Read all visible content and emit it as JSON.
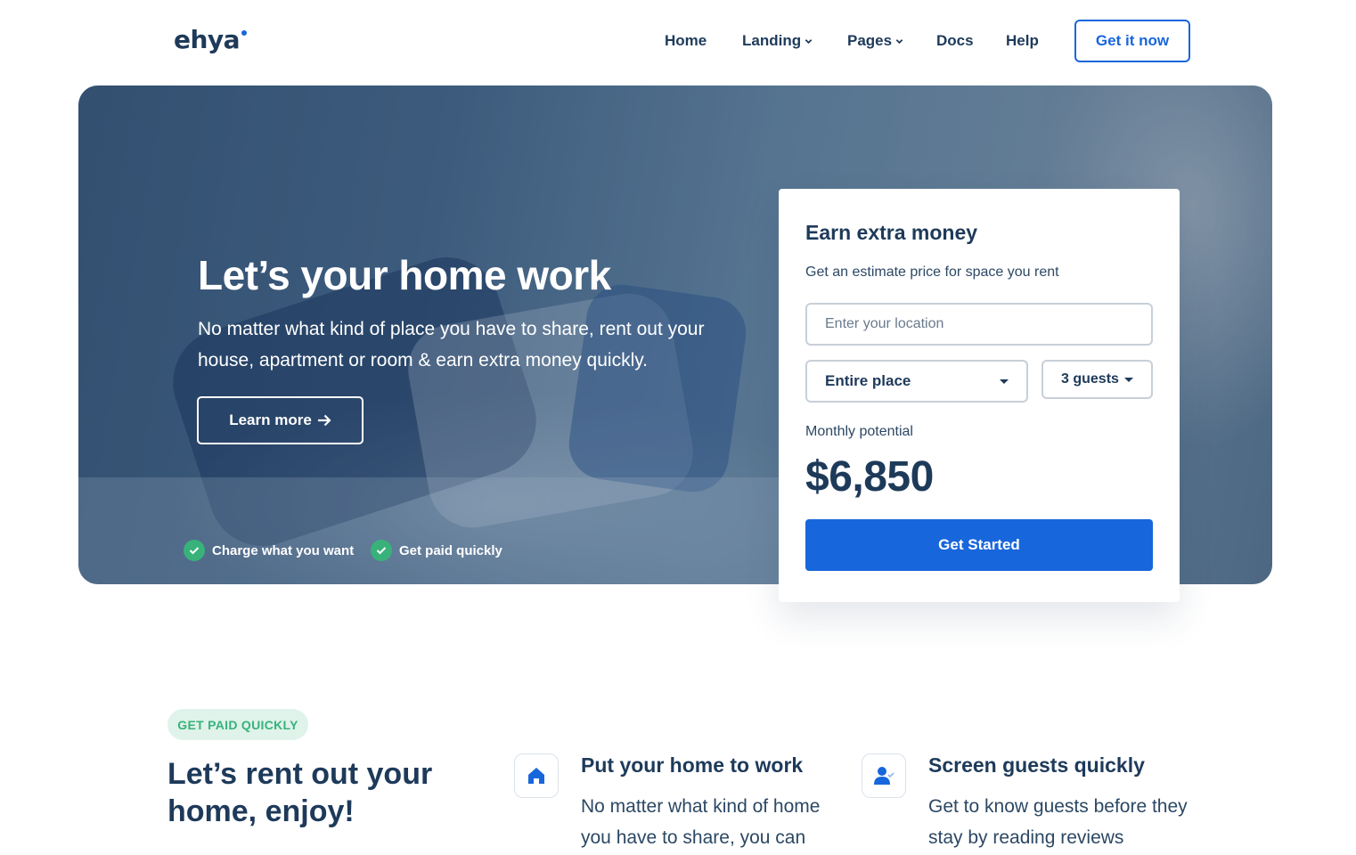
{
  "brand": {
    "logo_text": "ehya",
    "accent": "#1866dc"
  },
  "nav": {
    "items": [
      {
        "label": "Home",
        "has_dropdown": false
      },
      {
        "label": "Landing",
        "has_dropdown": true
      },
      {
        "label": "Pages",
        "has_dropdown": true
      },
      {
        "label": "Docs",
        "has_dropdown": false
      },
      {
        "label": "Help",
        "has_dropdown": false
      }
    ],
    "cta_label": "Get it now"
  },
  "hero": {
    "title": "Let’s your home work",
    "subtitle": "No matter what kind of place you have to share, rent out your house, apartment or room & earn extra money quickly.",
    "button_label": "Learn more",
    "checks": [
      "Charge what you want",
      "Get paid quickly"
    ],
    "check_color": "#38b27a"
  },
  "card": {
    "title": "Earn extra money",
    "subtitle": "Get an estimate price for space you rent",
    "location_placeholder": "Enter your location",
    "place_select": "Entire place",
    "guests_select": "3 guests",
    "potential_label": "Monthly potential",
    "potential_value": "$6,850",
    "button_label": "Get Started"
  },
  "section": {
    "badge": "GET PAID QUICKLY",
    "title": "Let’s rent out your home, enjoy!",
    "features": [
      {
        "icon": "home-icon",
        "title": "Put your home to work",
        "text": "No matter what kind of home you have to share, you can"
      },
      {
        "icon": "user-check-icon",
        "title": "Screen guests quickly",
        "text": "Get to know guests before they stay by reading reviews"
      }
    ]
  }
}
